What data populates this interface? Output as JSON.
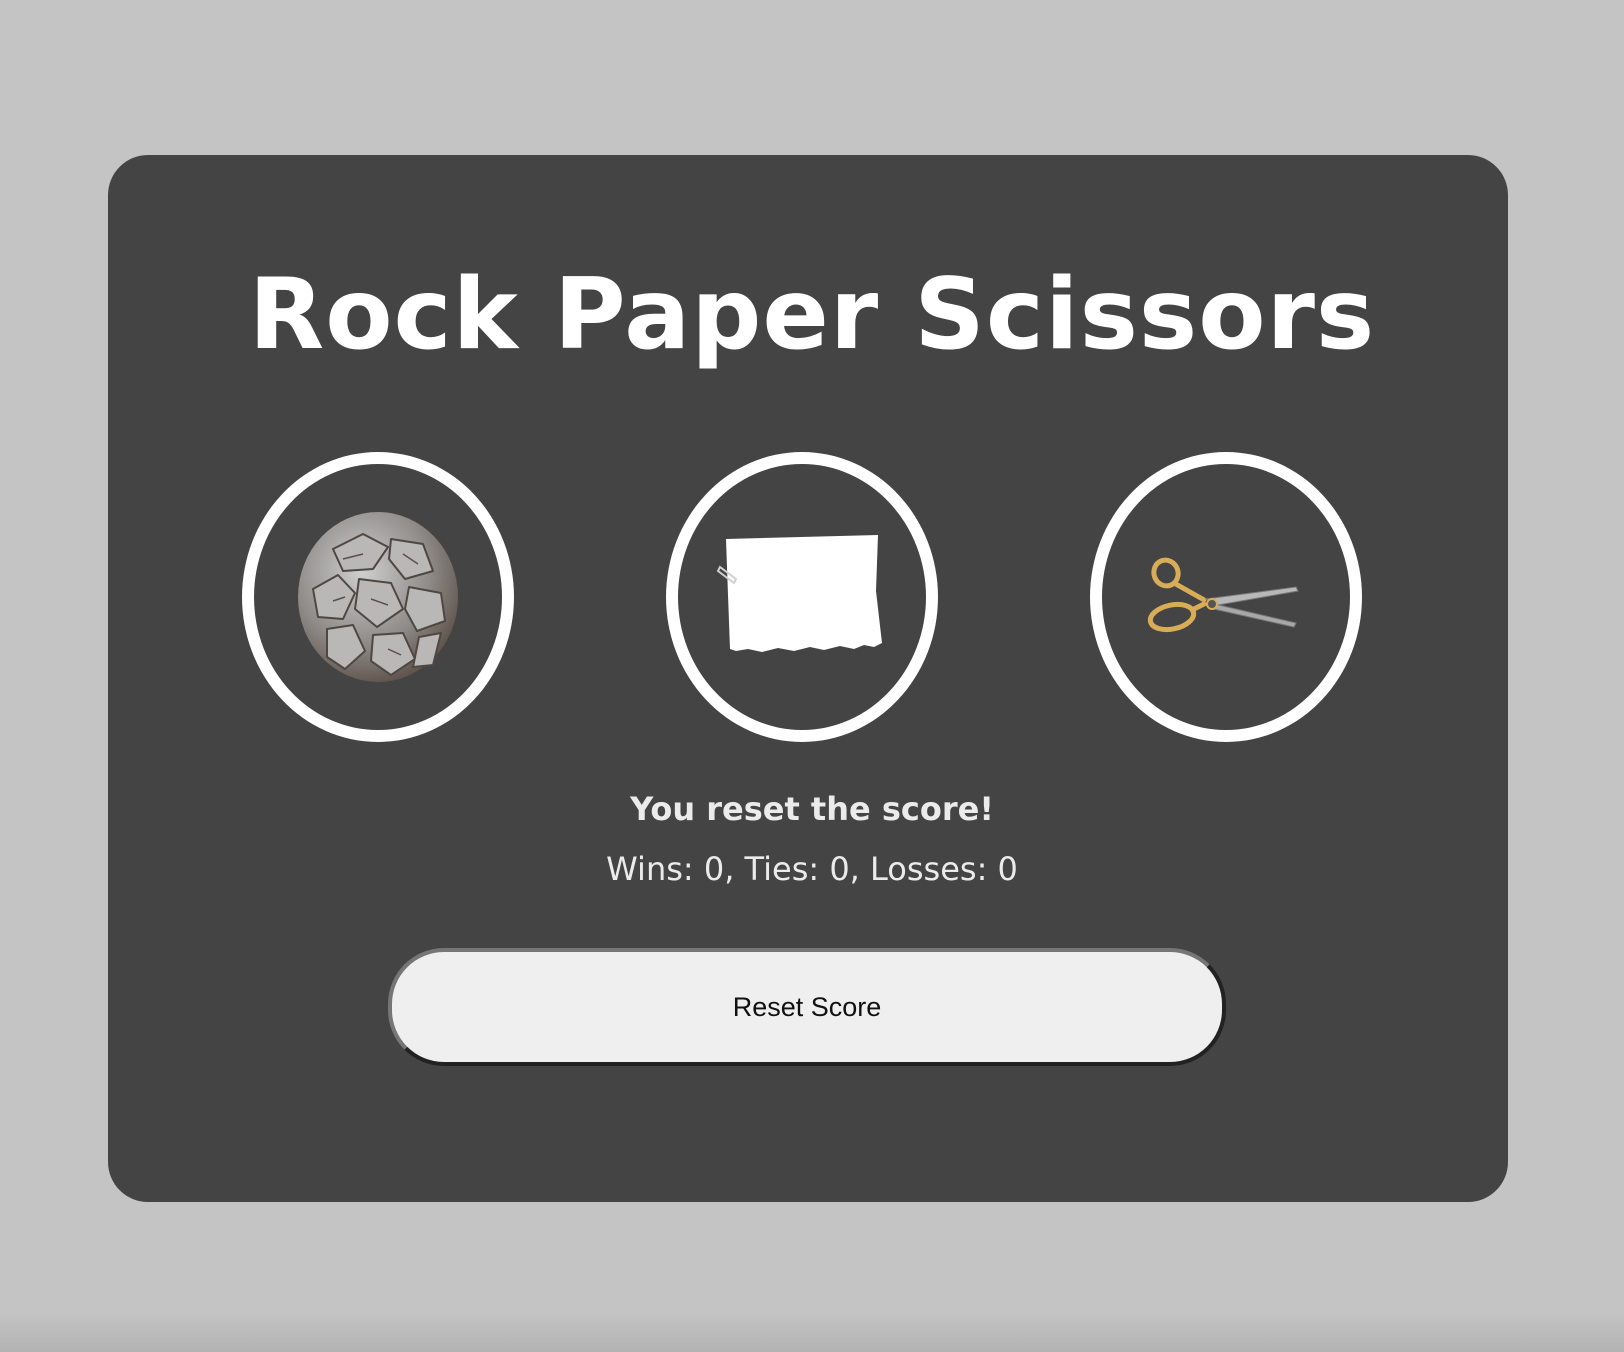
{
  "app": {
    "title": "Rock Paper Scissors"
  },
  "choices": [
    {
      "id": "rock",
      "icon": "rock-icon"
    },
    {
      "id": "paper",
      "icon": "paper-icon"
    },
    {
      "id": "scissors",
      "icon": "scissors-icon"
    }
  ],
  "status": {
    "result_message": "You reset the score!",
    "score_text": "Wins: 0, Ties: 0, Losses: 0"
  },
  "controls": {
    "reset_label": "Reset Score"
  },
  "colors": {
    "page_background": "#c4c4c4",
    "card_background": "#444444",
    "ring": "#ffffff",
    "button_background": "#efefef"
  }
}
